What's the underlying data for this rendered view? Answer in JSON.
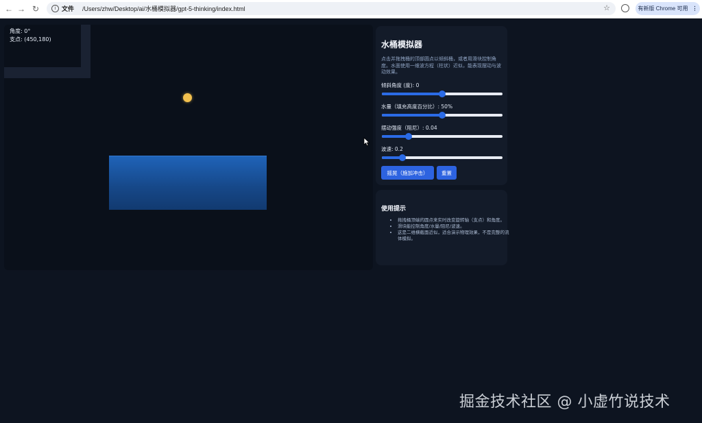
{
  "browser": {
    "back_icon": "←",
    "forward_icon": "→",
    "reload_icon": "↻",
    "info_icon": "i",
    "scheme_label": "文件",
    "url": "/Users/zhw/Desktop/ai/水桶模拟器/gpt-5-thinking/index.html",
    "star_icon": "☆",
    "update_label": "有新版 Chrome 可用",
    "menu_icon": "⋮"
  },
  "hud": {
    "angle": "角度: 0°",
    "pivot": "支点: (450,180)"
  },
  "panel": {
    "title": "水桶模拟器",
    "description": "点击并拖拽桶的顶部圆点以倾斜桶，或者用滑块控制角度。水面使用一维波方程（柱状）近似，能表现摆动与波动效果。",
    "sliders": [
      {
        "label": "倾斜角度 (度): 0",
        "value": 0.5
      },
      {
        "label": "水量（填充高度百分比）: 50%",
        "value": 0.5
      },
      {
        "label": "摆动强度（阻尼）: 0.04",
        "value": 0.22
      },
      {
        "label": "波速: 0.2",
        "value": 0.17
      }
    ],
    "shake_button": "摇晃（施加冲击）",
    "reset_button": "重置"
  },
  "tips": {
    "title": "使用提示",
    "items": [
      "拖拽桶顶端的圆点来实时改变旋转轴（支点）和角度。",
      "滑块能控制角度/水量/阻尼/波速。",
      "这是二维横截面近似，适合演示物理效果，不是完整的流体模拟。"
    ]
  },
  "watermark": "掘金技术社区 @ 小虚竹说技术",
  "colors": {
    "background": "#0d1420",
    "panel": "#131b29",
    "accent": "#2d63e0",
    "water": "#1f63b8",
    "handle": "#f2c04e"
  }
}
